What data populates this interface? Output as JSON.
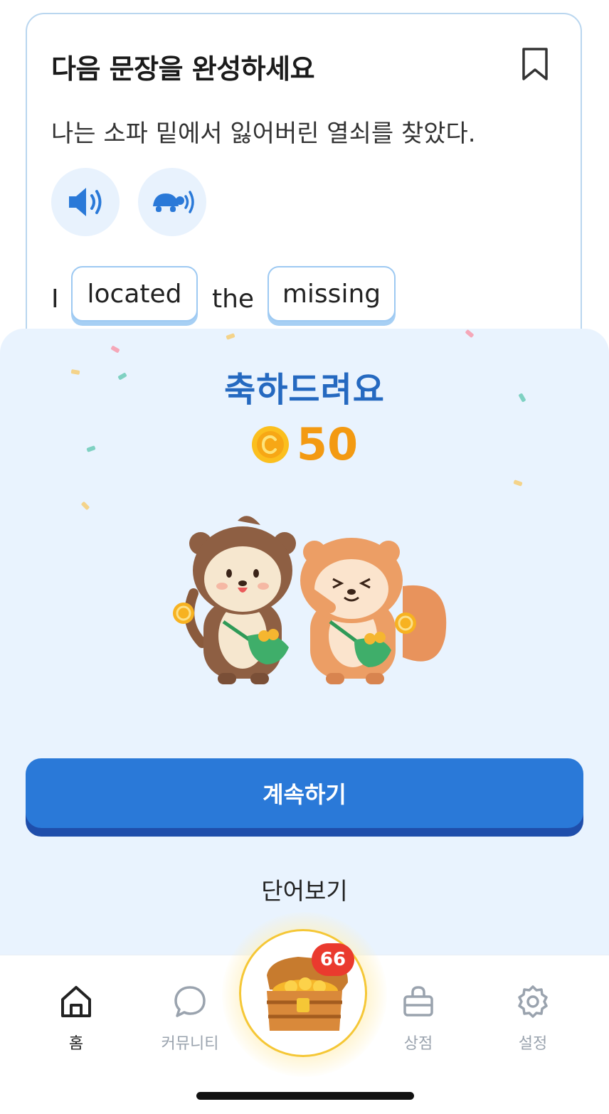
{
  "question": {
    "title": "다음 문장을 완성하세요",
    "sentence": "나는 소파 밑에서 잃어버린 열쇠를 찾았다.",
    "answer_words": [
      {
        "text": "I",
        "chip": false
      },
      {
        "text": "located",
        "chip": true
      },
      {
        "text": "the",
        "chip": false
      },
      {
        "text": "missing",
        "chip": true
      }
    ]
  },
  "result": {
    "title": "축하드려요",
    "reward_amount": "50",
    "continue_label": "계속하기",
    "vocab_label": "단어보기"
  },
  "nav": {
    "items": [
      {
        "label": "홈",
        "icon": "home-icon",
        "active": true
      },
      {
        "label": "커뮤니티",
        "icon": "chat-bubble-icon",
        "active": false
      },
      {
        "label": "상점",
        "icon": "shopping-bag-icon",
        "active": false
      },
      {
        "label": "설정",
        "icon": "gear-icon",
        "active": false
      }
    ],
    "chest_badge": "66"
  },
  "colors": {
    "primary": "#2a79d8",
    "title_blue": "#2569c0",
    "coin": "#f39a12",
    "sheet_bg": "#e9f3fe",
    "badge": "#ea3a2e"
  }
}
